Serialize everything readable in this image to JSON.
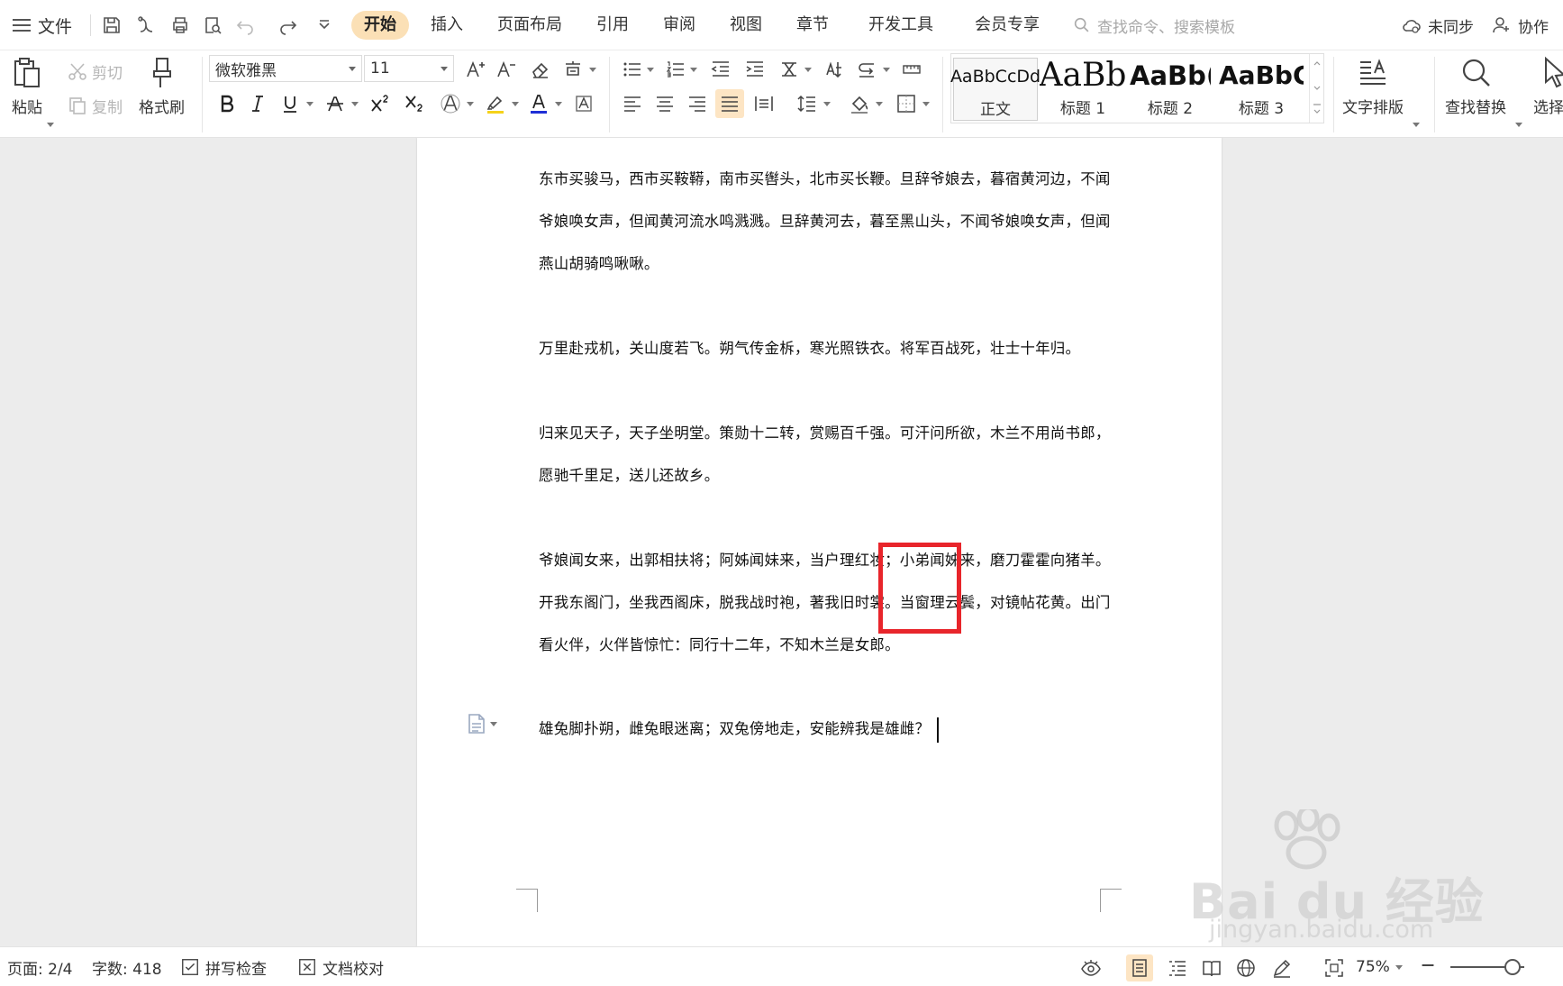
{
  "menubar": {
    "file_label": "文件",
    "tabs": [
      "开始",
      "插入",
      "页面布局",
      "引用",
      "审阅",
      "视图",
      "章节",
      "开发工具",
      "会员专享"
    ],
    "active_tab": "开始",
    "search_placeholder": "查找命令、搜索模板",
    "sync_label": "未同步",
    "collab_label": "协作"
  },
  "ribbon": {
    "paste_label": "粘贴",
    "cut_label": "剪切",
    "copy_label": "复制",
    "format_painter_label": "格式刷",
    "font_name": "微软雅黑",
    "font_size": "11",
    "styles": [
      {
        "sample": "AaBbCcDd",
        "name": "正文"
      },
      {
        "sample": "AaBb",
        "name": "标题 1"
      },
      {
        "sample": "AaBb(",
        "name": "标题 2"
      },
      {
        "sample": "AaBbC",
        "name": "标题 3"
      }
    ],
    "text_layout_label": "文字排版",
    "find_replace_label": "查找替换",
    "select_label": "选择",
    "colors": {
      "highlight": "#f5d21a",
      "font_color": "#1f2fd6"
    }
  },
  "document": {
    "paragraphs": [
      {
        "lines": [
          "东市买骏马，西市买鞍鞯，南市买辔头，北市买长鞭。旦辞爷娘去，暮宿黄河边，不闻",
          "爷娘唤女声，但闻黄河流水鸣溅溅。旦辞黄河去，暮至黑山头，不闻爷娘唤女声，但闻",
          "燕山胡骑鸣啾啾。"
        ]
      },
      {
        "lines": [
          "万里赴戎机，关山度若飞。朔气传金柝，寒光照铁衣。将军百战死，壮士十年归。"
        ]
      },
      {
        "lines": [
          "归来见天子，天子坐明堂。策勋十二转，赏赐百千强。可汗问所欲，木兰不用尚书郎，",
          "愿驰千里足，送儿还故乡。"
        ]
      },
      {
        "lines": [
          "爷娘闻女来，出郭相扶将；阿姊闻妹来，当户理红妆；小弟闻姊来，磨刀霍霍向猪羊。",
          "开我东阁门，坐我西阁床，脱我战时袍，著我旧时裳。当窗理云鬓，对镜帖花黄。出门",
          "看火伴，火伴皆惊忙：同行十二年，不知木兰是女郎。"
        ]
      },
      {
        "lines": [
          "雄兔脚扑朔，雌兔眼迷离；双兔傍地走，安能辨我是雄雌？"
        ]
      }
    ],
    "highlight_color": "#e8252b"
  },
  "watermark": {
    "brand": "Bai du 经验",
    "url": "jingyan.baidu.com"
  },
  "statusbar": {
    "page": "页面: 2/4",
    "words": "字数: 418",
    "spell_check": "拼写检查",
    "doc_proof": "文档校对",
    "zoom": "75%"
  }
}
